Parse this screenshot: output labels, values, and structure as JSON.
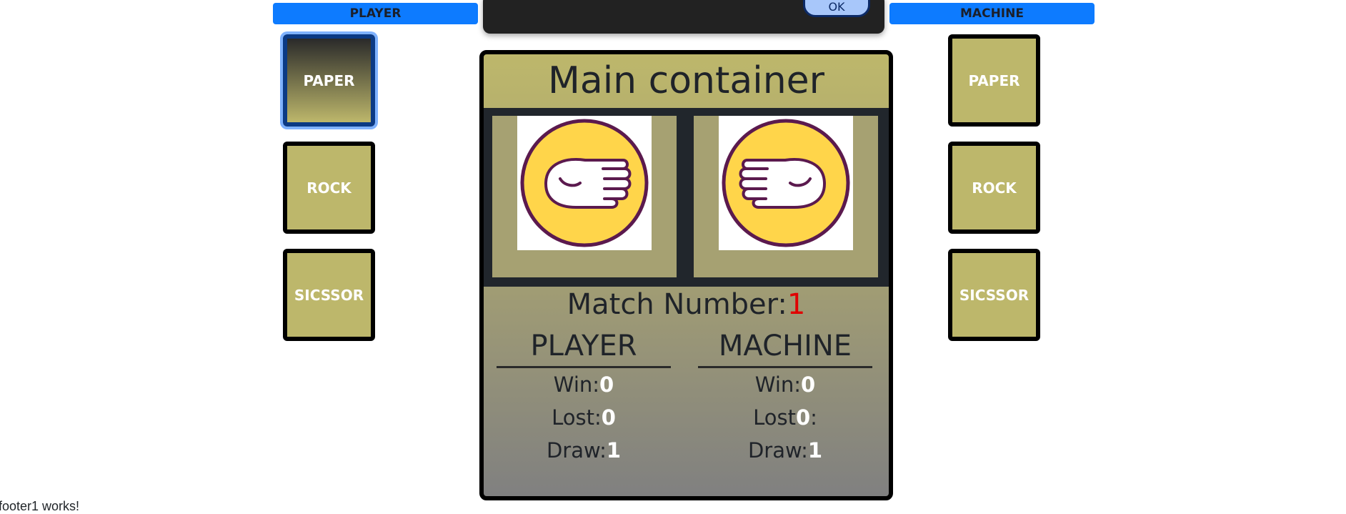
{
  "sides": {
    "player": "PLAYER",
    "machine": "MACHINE"
  },
  "choices": {
    "paper": "PAPER",
    "rock": "ROCK",
    "scissor": "SICSSOR"
  },
  "dialog": {
    "ok_label": "OK"
  },
  "main": {
    "title": "Main container",
    "player_hand": "paper-hand-icon",
    "machine_hand": "paper-hand-icon",
    "match_label": "Match Number:",
    "match_number": "1",
    "player": {
      "title": "PLAYER",
      "win_label": "Win:",
      "win": "0",
      "lost_label": "Lost:",
      "lost": "0",
      "draw_label": "Draw:",
      "draw": "1"
    },
    "machine": {
      "title": "MACHINE",
      "win_label": "Win:",
      "win": "0",
      "lost_label": "Lost",
      "lost": "0",
      "lost_suffix": ":",
      "draw_label": "Draw:",
      "draw": "1"
    }
  },
  "footer": "footer1 works!",
  "colors": {
    "accent": "#0d7bff",
    "khaki": "#bdb76b",
    "match_number": "#e00000"
  }
}
